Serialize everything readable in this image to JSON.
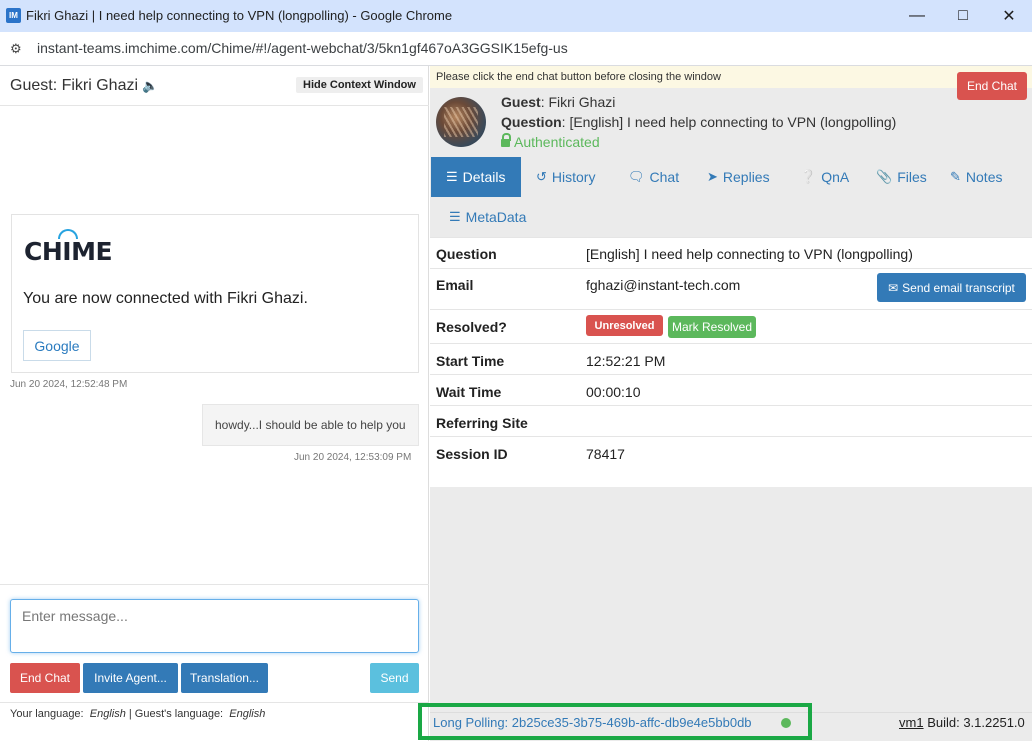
{
  "window": {
    "title": "Fikri Ghazi | I need help connecting to VPN (longpolling) - Google Chrome",
    "url": "instant-teams.imchime.com/Chime/#!/agent-webchat/3/5kn1gf467oA3GGSIK15efg-us",
    "app_icon_text": "IM"
  },
  "left": {
    "guest_header": "Guest: Fikri Ghazi",
    "hide_context_label": "Hide Context Window",
    "welcome": {
      "logo_text": "CHIME",
      "connected_text": "You are now connected with Fikri Ghazi.",
      "google_button": "Google",
      "timestamp": "Jun 20 2024, 12:52:48 PM"
    },
    "agent_message": {
      "text": "howdy...I should be able to help you",
      "timestamp": "Jun 20 2024, 12:53:09 PM"
    },
    "compose": {
      "placeholder": "Enter message...",
      "end_chat": "End Chat",
      "invite_agent": "Invite Agent...",
      "translation": "Translation...",
      "send": "Send"
    },
    "language": {
      "your_label": "Your language:",
      "your_value": "English",
      "guest_label": "| Guest's language:",
      "guest_value": "English"
    }
  },
  "right": {
    "warning": "Please click the end chat button before closing the window",
    "end_chat": "End Chat",
    "guest": {
      "label": "Guest",
      "value": ": Fikri Ghazi"
    },
    "question": {
      "label": "Question",
      "value": ": [English] I need help connecting to VPN (longpolling)"
    },
    "authenticated": "Authenticated",
    "tabs": [
      {
        "label": "Details",
        "icon": "list-icon",
        "active": true
      },
      {
        "label": "History",
        "icon": "history-icon"
      },
      {
        "label": "Chat",
        "icon": "chat-icon"
      },
      {
        "label": "Replies",
        "icon": "paper-plane-icon"
      },
      {
        "label": "QnA",
        "icon": "question-circle-icon"
      },
      {
        "label": "Files",
        "icon": "paperclip-icon"
      },
      {
        "label": "Notes",
        "icon": "edit-icon"
      },
      {
        "label": "MetaData",
        "icon": "list-icon"
      }
    ],
    "details": {
      "question_label": "Question",
      "question_value": "[English] I need help connecting to VPN (longpolling)",
      "email_label": "Email",
      "email_value": "fghazi@instant-tech.com",
      "send_transcript": "Send email transcript",
      "resolved_label": "Resolved?",
      "unresolved_badge": "Unresolved",
      "mark_resolved": "Mark Resolved",
      "start_time_label": "Start Time",
      "start_time_value": "12:52:21 PM",
      "wait_time_label": "Wait Time",
      "wait_time_value": "00:00:10",
      "referring_site_label": "Referring Site",
      "referring_site_value": "",
      "session_id_label": "Session ID",
      "session_id_value": "78417"
    },
    "footer": {
      "long_polling": "Long Polling: 2b25ce35-3b75-469b-affc-db9e4e5bb0db",
      "vm": "vm1",
      "build": "Build: 3.1.2251.0"
    }
  },
  "colors": {
    "primary": "#337ab7",
    "danger": "#d9534f",
    "success": "#5cb85c",
    "info": "#5bc0de",
    "highlight_box": "#1aa845"
  }
}
